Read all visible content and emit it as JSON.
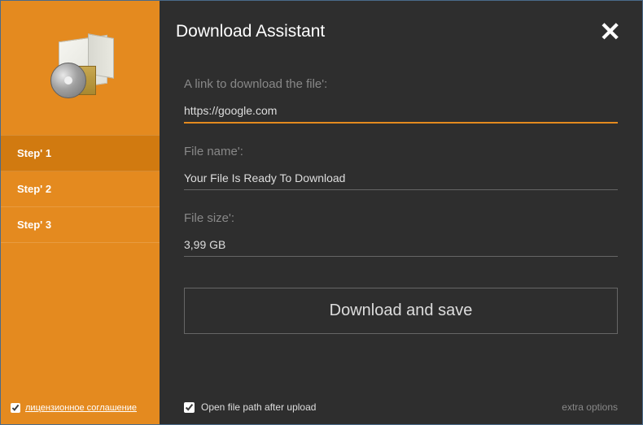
{
  "header": {
    "title": "Download Assistant"
  },
  "sidebar": {
    "steps": [
      {
        "label": "Step' 1",
        "active": true
      },
      {
        "label": "Step' 2",
        "active": false
      },
      {
        "label": "Step' 3",
        "active": false
      }
    ],
    "license": {
      "checked": true,
      "label": "лицензионное соглашение"
    }
  },
  "form": {
    "link": {
      "label": "A link to download the file':",
      "value": "https://google.com"
    },
    "name": {
      "label": "File name':",
      "value": "Your File Is Ready To Download"
    },
    "size": {
      "label": "File size':",
      "value": "3,99 GB"
    },
    "submit_label": "Download and save"
  },
  "footer": {
    "open_path": {
      "checked": true,
      "label": "Open file path after upload"
    },
    "extra_label": "extra options"
  },
  "colors": {
    "accent": "#e48a1f",
    "bg_dark": "#2e2e2e"
  }
}
